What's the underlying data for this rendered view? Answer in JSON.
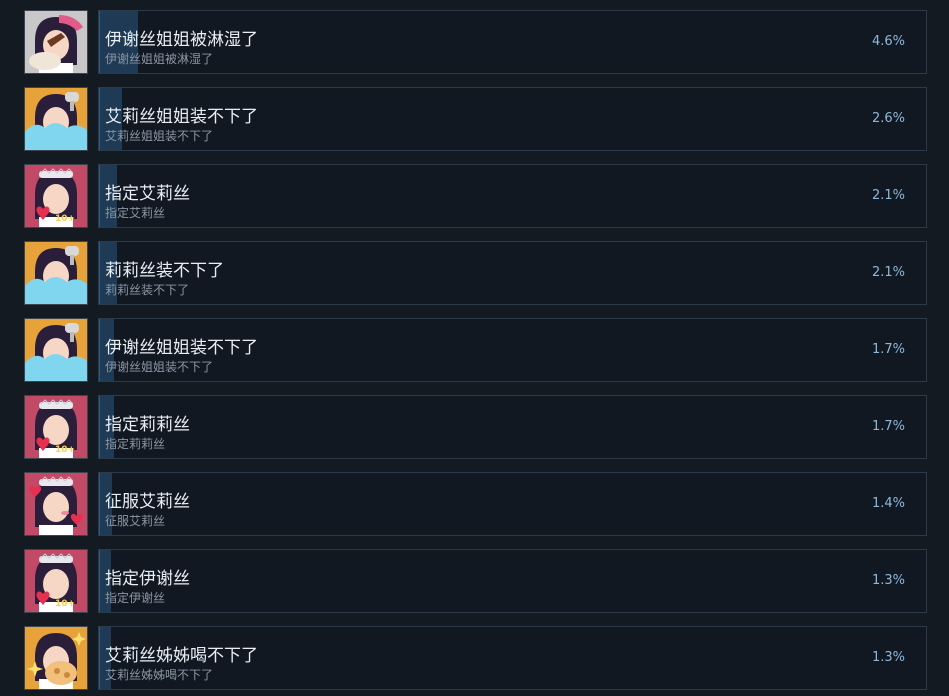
{
  "achievements": [
    {
      "title": "伊谢丝姐姐被淋湿了",
      "desc": "伊谢丝姐姐被淋湿了",
      "percent": "4.6%",
      "fill": 4.6,
      "icon": "isis-wet-icon",
      "bg": "#c8c8c8"
    },
    {
      "title": "艾莉丝姐姐装不下了",
      "desc": "艾莉丝姐姐装不下了",
      "percent": "2.6%",
      "fill": 2.6,
      "icon": "alice-overflow-icon",
      "bg": "#e8a23a"
    },
    {
      "title": "指定艾莉丝",
      "desc": "指定艾莉丝",
      "percent": "2.1%",
      "fill": 2.1,
      "icon": "maid-heart-10-icon",
      "bg": "#c24a66"
    },
    {
      "title": "莉莉丝装不下了",
      "desc": "莉莉丝装不下了",
      "percent": "2.1%",
      "fill": 2.1,
      "icon": "lilith-overflow-icon",
      "bg": "#e8a23a"
    },
    {
      "title": "伊谢丝姐姐装不下了",
      "desc": "伊谢丝姐姐装不下了",
      "percent": "1.7%",
      "fill": 1.7,
      "icon": "isis-overflow-icon",
      "bg": "#e8a23a"
    },
    {
      "title": "指定莉莉丝",
      "desc": "指定莉莉丝",
      "percent": "1.7%",
      "fill": 1.7,
      "icon": "maid-heart-10-icon",
      "bg": "#c24a66"
    },
    {
      "title": "征服艾莉丝",
      "desc": "征服艾莉丝",
      "percent": "1.4%",
      "fill": 1.4,
      "icon": "maid-blush-hearts-icon",
      "bg": "#c24a66"
    },
    {
      "title": "指定伊谢丝",
      "desc": "指定伊谢丝",
      "percent": "1.3%",
      "fill": 1.3,
      "icon": "maid-heart-10-icon",
      "bg": "#c24a66"
    },
    {
      "title": "艾莉丝姊姊喝不下了",
      "desc": "艾莉丝姊姊喝不下了",
      "percent": "1.3%",
      "fill": 1.3,
      "icon": "alice-drink-sparkle-icon",
      "bg": "#e8a23a"
    }
  ]
}
